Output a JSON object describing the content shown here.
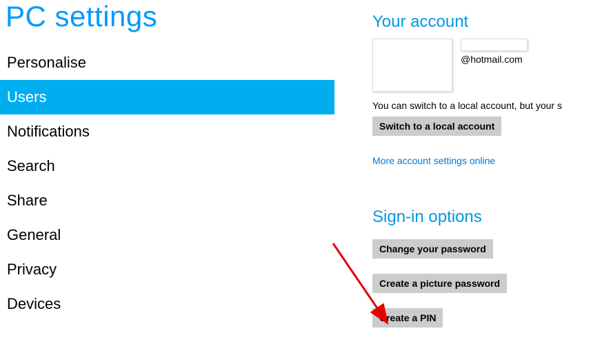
{
  "page": {
    "title": "PC settings"
  },
  "sidebar": {
    "items": [
      {
        "label": "Personalise",
        "selected": false
      },
      {
        "label": "Users",
        "selected": true
      },
      {
        "label": "Notifications",
        "selected": false
      },
      {
        "label": "Search",
        "selected": false
      },
      {
        "label": "Share",
        "selected": false
      },
      {
        "label": "General",
        "selected": false
      },
      {
        "label": "Privacy",
        "selected": false
      },
      {
        "label": "Devices",
        "selected": false
      }
    ]
  },
  "content": {
    "account": {
      "title": "Your account",
      "email": "@hotmail.com",
      "note": "You can switch to a local account, but your s",
      "switch_button": "Switch to a local account",
      "more_link": "More account settings online"
    },
    "signin": {
      "title": "Sign-in options",
      "buttons": [
        {
          "label": "Change your password"
        },
        {
          "label": "Create a picture password"
        },
        {
          "label": "Create a PIN"
        }
      ]
    }
  }
}
